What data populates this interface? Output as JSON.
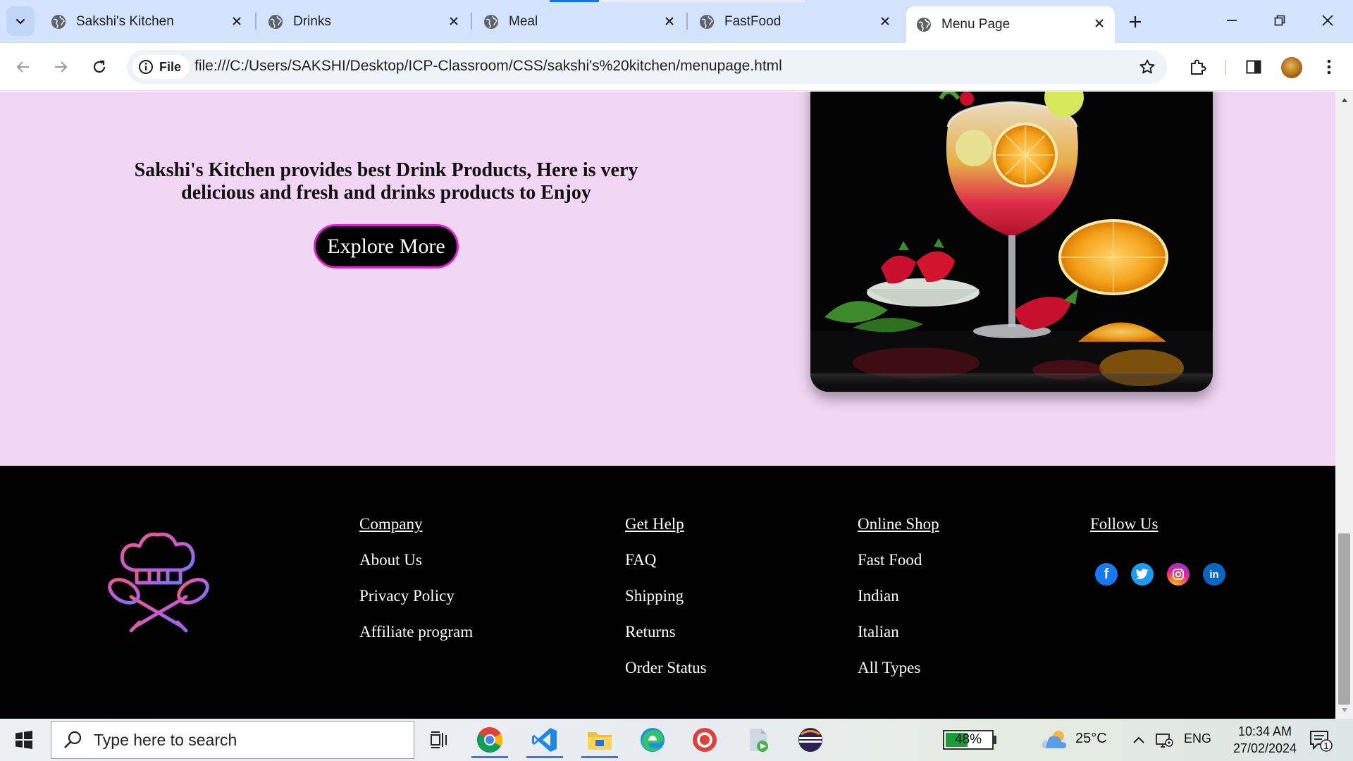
{
  "browser": {
    "tabs": [
      {
        "label": "Sakshi's Kitchen",
        "active": false
      },
      {
        "label": "Drinks",
        "active": false
      },
      {
        "label": "Meal",
        "active": false
      },
      {
        "label": "FastFood",
        "active": false
      },
      {
        "label": "Menu Page",
        "active": true
      }
    ],
    "site_chip_label": "File",
    "url": "file:///C:/Users/SAKSHI/Desktop/ICP-Classroom/CSS/sakshi's%20kitchen/menupage.html"
  },
  "page": {
    "hero": {
      "headline": "Sakshi's Kitchen provides best Drink Products, Here is very delicious and fresh and drinks products to Enjoy",
      "button_label": "Explore More",
      "image": "cocktail glass with orange slices and strawberries on black background"
    },
    "footer": {
      "columns": [
        {
          "heading": "Company",
          "links": [
            "About Us",
            "Privacy Policy",
            "Affiliate program"
          ]
        },
        {
          "heading": "Get Help",
          "links": [
            "FAQ",
            "Shipping",
            "Returns",
            "Order Status"
          ]
        },
        {
          "heading": "Online Shop",
          "links": [
            "Fast Food",
            "Indian",
            "Italian",
            "All Types"
          ]
        },
        {
          "heading": "Follow Us",
          "links": []
        }
      ],
      "social_icons": [
        {
          "name": "facebook-icon",
          "color": "#1877f2",
          "glyph": "f"
        },
        {
          "name": "twitter-icon",
          "color": "#1d9bf0",
          "glyph": "t"
        },
        {
          "name": "instagram-icon",
          "color": "#d6249f",
          "glyph": "◎"
        },
        {
          "name": "linkedin-icon",
          "color": "#0a66c2",
          "glyph": "in"
        }
      ]
    }
  },
  "taskbar": {
    "search_placeholder": "Type here to search",
    "battery_percent": "48%",
    "battery_level": 0.48,
    "temperature": "25°C",
    "language": "ENG",
    "time": "10:34 AM",
    "date": "27/02/2024",
    "notification_count": "1"
  },
  "colors": {
    "hero_bg": "#f2d7f4",
    "button_border": "#e020d8",
    "footer_bg": "#000000",
    "tabstrip_bg": "#d3e3fd"
  }
}
